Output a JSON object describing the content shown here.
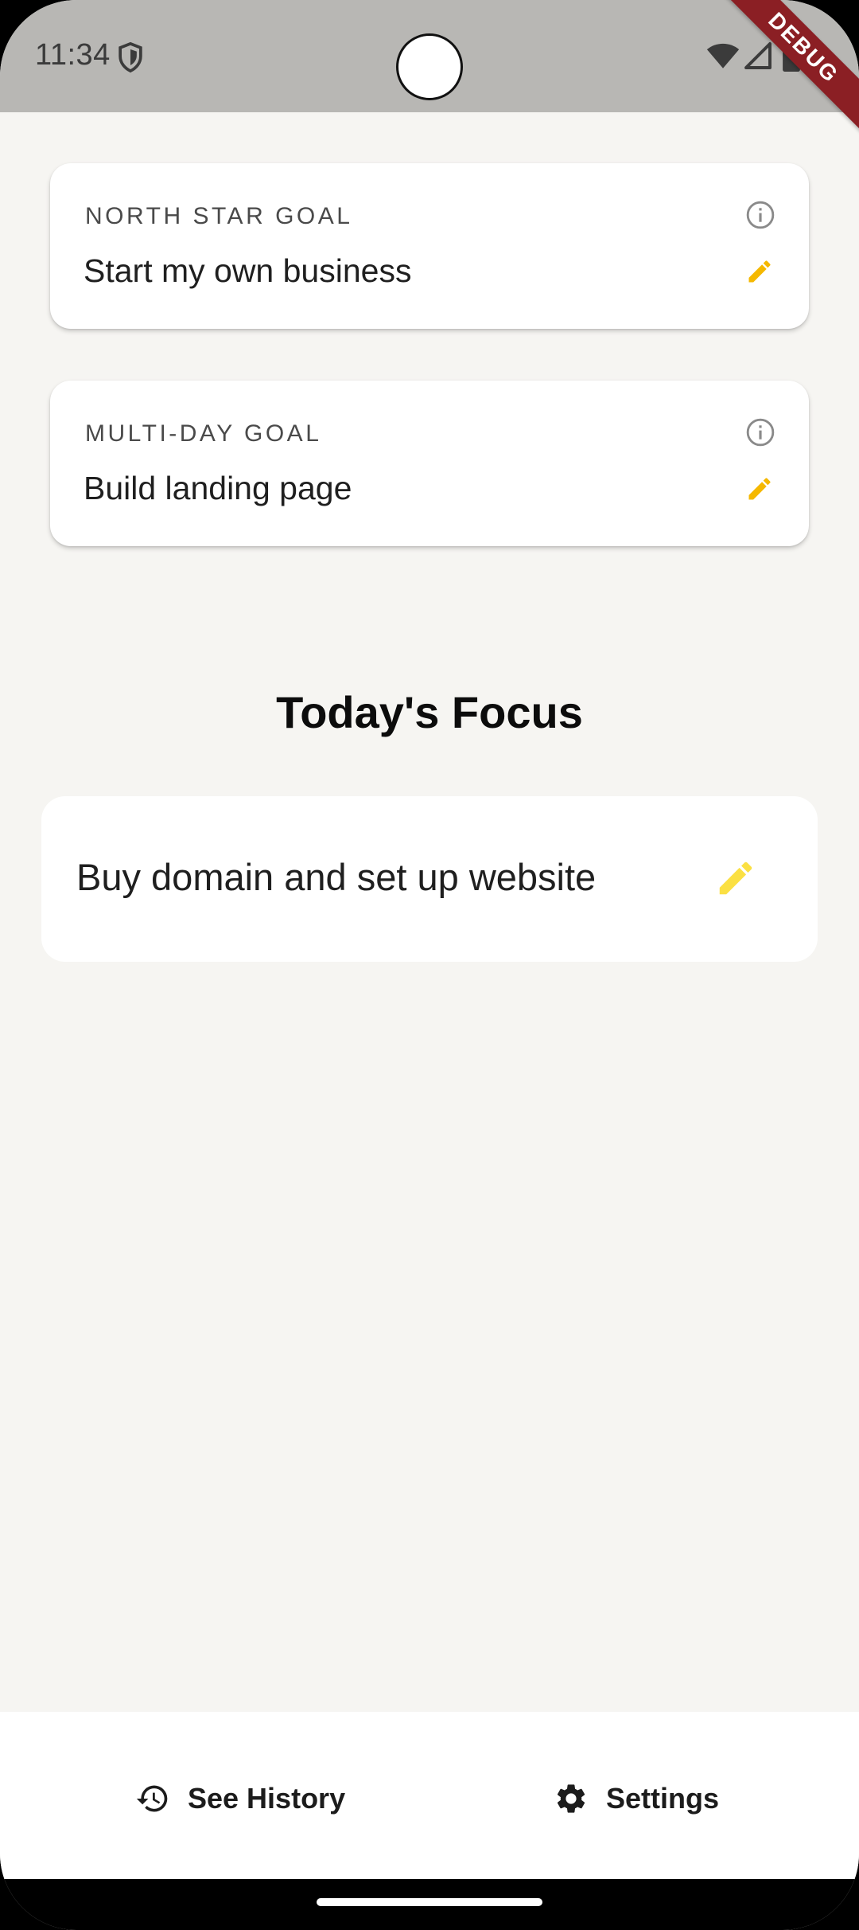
{
  "status_bar": {
    "time": "11:34",
    "debug_banner": "DEBUG",
    "icons": [
      "shield-icon",
      "wifi-icon",
      "cell-signal-icon",
      "battery-icon"
    ]
  },
  "goals": {
    "north_star": {
      "label": "NORTH STAR GOAL",
      "text": "Start my own business"
    },
    "multi_day": {
      "label": "MULTI-DAY GOAL",
      "text": "Build landing page"
    }
  },
  "focus": {
    "title": "Today's Focus",
    "task": "Buy domain and set up website"
  },
  "bottom_bar": {
    "history_label": "See History",
    "settings_label": "Settings"
  },
  "colors": {
    "background": "#f6f5f2",
    "status_bar": "#b8b7b4",
    "edit_accent_small": "#f5b800",
    "edit_accent_large": "#fbe043",
    "debug_ribbon": "#8b1f24"
  }
}
